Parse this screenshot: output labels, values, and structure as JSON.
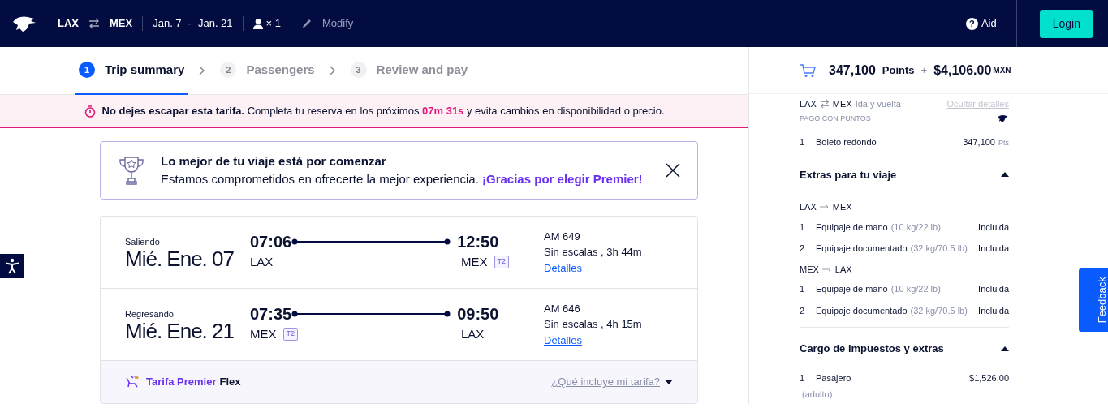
{
  "header": {
    "origin": "LAX",
    "destination": "MEX",
    "date_from": "Jan. 7",
    "date_sep": "-",
    "date_to": "Jan. 21",
    "passengers": "× 1",
    "modify": "Modify",
    "help_mark": "?",
    "help": "Aid",
    "login": "Login"
  },
  "steps": [
    {
      "number": "1",
      "label": "Trip summary",
      "selected": true
    },
    {
      "number": "2",
      "label": "Passengers",
      "selected": false
    },
    {
      "number": "3",
      "label": "Review and pay",
      "selected": false
    }
  ],
  "alert": {
    "text": "**No dejes escapar esta tarifa.** Completa tu reserva en los próximos **07m 31s** y evita cambios en disponibilidad o precio."
  },
  "promo": {
    "title": "Lo mejor de tu viaje está por comenzar",
    "text": "Estamos comprometidos en ofrecerte la mejor experiencia. **¡Gracias por elegir Premier!**"
  },
  "flights": [
    {
      "label": "Saliendo",
      "date": "Mié. Ene. 07",
      "depart_time": "07:06",
      "depart_airport": "LAX",
      "arrive_time": "12:50",
      "arrive_airport": "MEX",
      "arrive_terminal": "T2",
      "flight": "AM 649",
      "info": "Sin escalas , 3h 44m",
      "details": "Detalles"
    },
    {
      "label": "Regresando",
      "date": "Mié. Ene. 21",
      "depart_time": "07:35",
      "depart_airport": "MEX",
      "depart_terminal": "T2",
      "arrive_time": "09:50",
      "arrive_airport": "LAX",
      "flight": "AM 646",
      "info": "Sin escalas , 4h 15m",
      "details": "Detalles"
    }
  ],
  "fare": {
    "brand": "Tarifa Premier",
    "tier": "Flex",
    "link": "¿Qué incluye mi tarifa?"
  },
  "summary": {
    "points": "347,100",
    "points_label": "Points",
    "plus": "+",
    "amount": "$4,106.00",
    "currency": "MXN",
    "route_from": "LAX",
    "route_to": "MEX",
    "trip_type": "Ida y vuelta",
    "hide_link": "Ocultar detalles",
    "payment_label": "PAGO CON PUNTOS",
    "ticket": {
      "qty": "1",
      "name": "Boleto redondo",
      "value": "347,100",
      "unit": "Pts"
    },
    "sections": [
      {
        "title": "Extras para tu viaje",
        "expanded": true,
        "groups": [
          {
            "from": "LAX",
            "to": "MEX",
            "items": [
              {
                "qty": "1",
                "name": "Equipaje de mano",
                "note": "(10 kg/22 lb)",
                "value": "Incluida"
              },
              {
                "qty": "2",
                "name": "Equipaje documentado",
                "note": "(32 kg/70.5 lb)",
                "value": "Incluida"
              }
            ]
          },
          {
            "from": "MEX",
            "to": "LAX",
            "items": [
              {
                "qty": "1",
                "name": "Equipaje de mano",
                "note": "(10 kg/22 lb)",
                "value": "Incluida"
              },
              {
                "qty": "2",
                "name": "Equipaje documentado",
                "note": "(32 kg/70.5 lb)",
                "value": "Incluida"
              }
            ]
          }
        ]
      },
      {
        "title": "Cargo de impuestos y extras",
        "expanded": true,
        "groups": [
          {
            "items": [
              {
                "qty": "1",
                "name": "Pasajero",
                "value": "$1,526.00",
                "sub": "(adulto)"
              }
            ]
          }
        ]
      }
    ]
  },
  "feedback": "Feedback"
}
